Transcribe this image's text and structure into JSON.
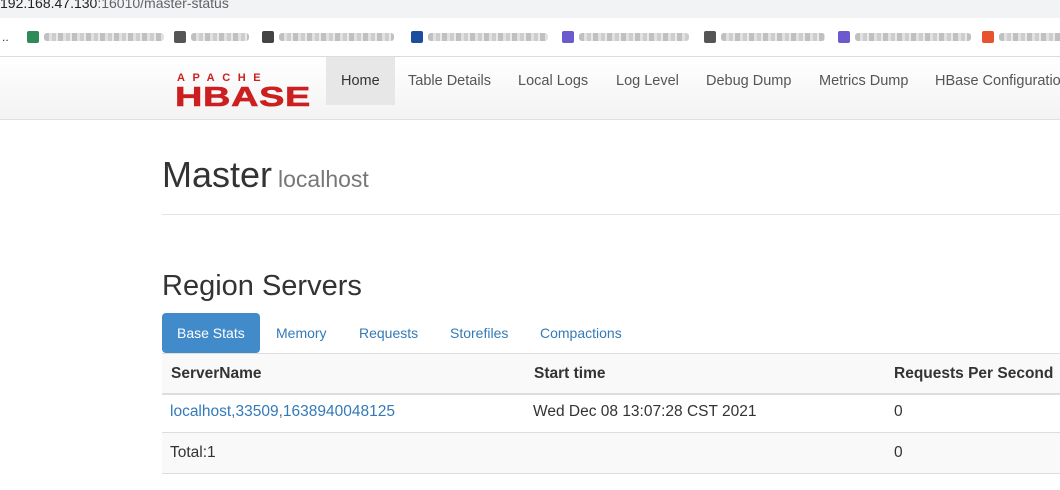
{
  "browser": {
    "url_host": "192.168.47.130",
    "url_rest": ":16010/master-status",
    "bookmarks_ellipsis": "..",
    "bookmarks": [
      {
        "icon": "bookmark-icon",
        "color": "#2e8b57"
      },
      {
        "icon": "bookmark-icon",
        "color": "#555555"
      },
      {
        "icon": "bookmark-icon",
        "color": "#444444"
      },
      {
        "icon": "bookmark-icon",
        "color": "#1a4fa0"
      },
      {
        "icon": "bookmark-icon",
        "color": "#6a5acd"
      },
      {
        "icon": "bookmark-icon",
        "color": "#555555"
      },
      {
        "icon": "bookmark-icon",
        "color": "#6a5acd"
      },
      {
        "icon": "bookmark-icon",
        "color": "#e8532f"
      }
    ]
  },
  "brand": {
    "top": "APACHE",
    "bottom": "HBASE",
    "red": "#cc1f1f"
  },
  "nav": {
    "items": [
      "Home",
      "Table Details",
      "Local Logs",
      "Log Level",
      "Debug Dump",
      "Metrics Dump",
      "HBase Configuration"
    ]
  },
  "page": {
    "title": "Master",
    "subtitle": "localhost"
  },
  "region_servers": {
    "title": "Region Servers",
    "tabs": [
      "Base Stats",
      "Memory",
      "Requests",
      "Storefiles",
      "Compactions"
    ],
    "columns": [
      "ServerName",
      "Start time",
      "Requests Per Second"
    ],
    "rows": [
      {
        "server": "localhost,33509,1638940048125",
        "start_time": "Wed Dec 08 13:07:28 CST 2021",
        "rps": "0"
      }
    ],
    "total": {
      "label": "Total:1",
      "rps": "0"
    }
  }
}
